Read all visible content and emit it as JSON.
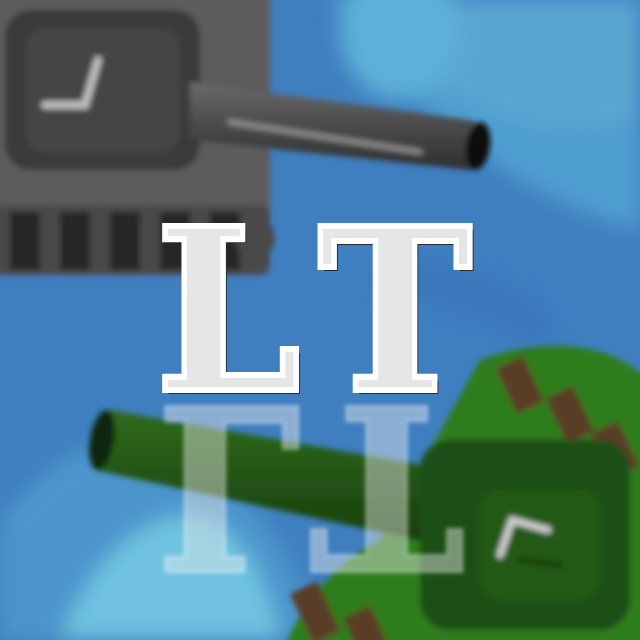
{
  "logo": {
    "letters": [
      "L",
      "T"
    ]
  },
  "colors": {
    "water_dark": "#3f7fc0",
    "water_light": "#5aa6d2",
    "shore_light": "#6fc2e0",
    "gray_tank_body": "#5c5c5c",
    "gray_tank_dark": "#3b3b3b",
    "gray_tank_tread": "#262626",
    "green_tank_body": "#2e7d1a",
    "green_tank_dark": "#1f4f12",
    "green_tank_tread": "#5a3d25",
    "logo_fill": "#e6e6e6",
    "logo_outline": "#2b2b2b"
  },
  "scene": {
    "gray_tank": {
      "icon": "gray-tank-icon",
      "direction": "right"
    },
    "green_tank": {
      "icon": "green-tank-icon",
      "direction": "left"
    }
  }
}
